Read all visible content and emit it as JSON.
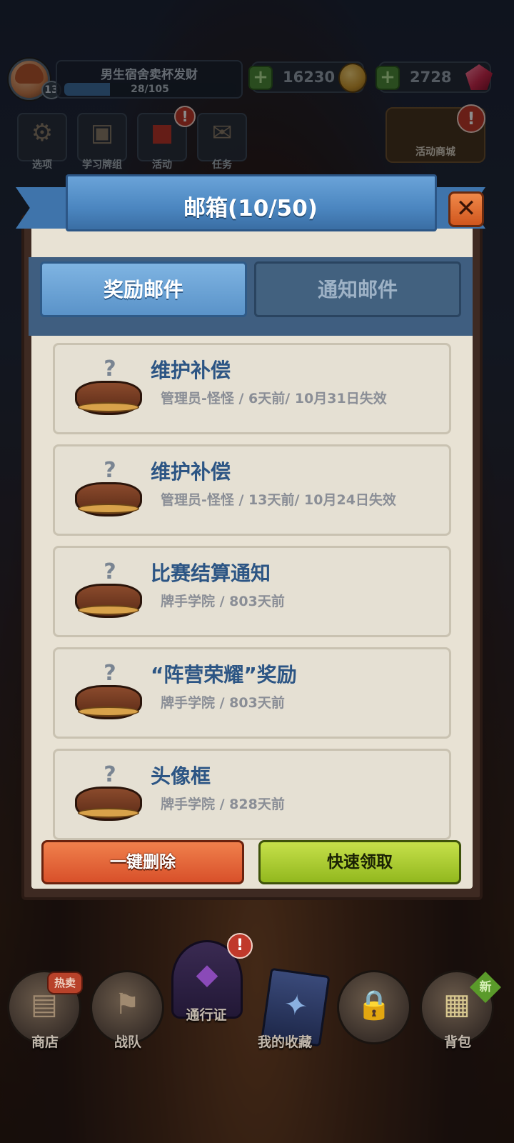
{
  "player": {
    "name": "男生宿舍卖杯发财",
    "level": "13",
    "xp_text": "28/105",
    "xp_fraction": 0.267
  },
  "currencies": {
    "gold": "16230",
    "gems": "2728"
  },
  "menu": {
    "items": [
      {
        "label": "选项",
        "icon": "gear-icon"
      },
      {
        "label": "学习牌组",
        "icon": "tv-icon"
      },
      {
        "label": "活动",
        "icon": "gift-icon"
      },
      {
        "label": "任务",
        "icon": "scroll-icon"
      }
    ],
    "event_shop": "活动商城",
    "alert": "!"
  },
  "dialog": {
    "title": "邮箱(10/50)",
    "close": "✕",
    "tabs": [
      {
        "label": "奖励邮件",
        "active": true
      },
      {
        "label": "通知邮件",
        "active": false
      }
    ]
  },
  "mails": [
    {
      "title": "维护补偿",
      "meta": "管理员-怪怪 / 6天前/  10月31日失效"
    },
    {
      "title": "维护补偿",
      "meta": "管理员-怪怪 / 13天前/  10月24日失效"
    },
    {
      "title": "比赛结算通知",
      "meta": "牌手学院 / 803天前"
    },
    {
      "title": "“阵营荣耀”奖励",
      "meta": "牌手学院 / 803天前"
    },
    {
      "title": "头像框",
      "meta": "牌手学院 / 828天前"
    }
  ],
  "actions": {
    "delete_all": "一键删除",
    "quick_claim": "快速领取"
  },
  "bottom_nav": {
    "items": [
      {
        "label": "商店",
        "icon": "shop-cart-icon"
      },
      {
        "label": "战队",
        "icon": "banner-icon"
      },
      {
        "label": "通行证",
        "icon": "pass-icon"
      },
      {
        "label": "我的收藏",
        "icon": "card-book-icon"
      },
      {
        "label": "",
        "icon": "lock-icon"
      },
      {
        "label": "背包",
        "icon": "backpack-icon"
      }
    ],
    "hot_badge": "热卖",
    "new_badge": "新"
  },
  "colors": {
    "ribbon_blue": "#4b86c0",
    "title_text": "#2c5584",
    "delete_orange": "#d8502a",
    "claim_green": "#92b81e"
  }
}
